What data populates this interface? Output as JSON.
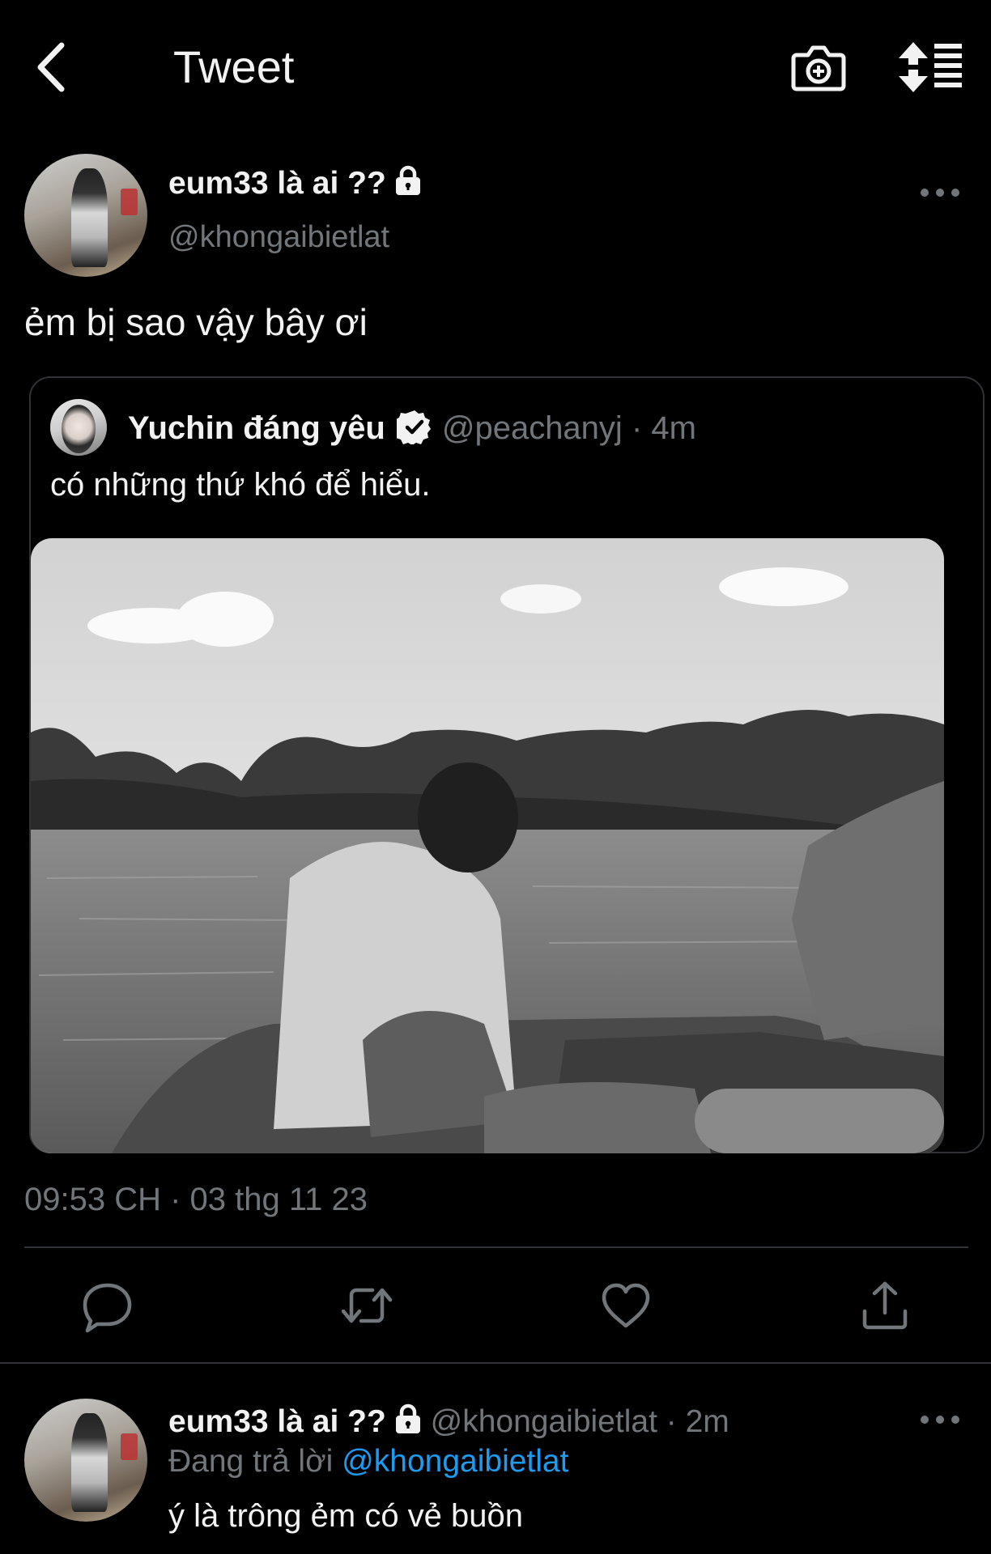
{
  "header": {
    "title": "Tweet",
    "back_icon": "chevron-left-icon",
    "camera_icon": "camera-add-icon",
    "sort_icon": "sort-list-icon"
  },
  "tweet": {
    "author": {
      "display_name": "eum33 là ai ??",
      "handle": "@khongaibietlat",
      "protected_icon": "lock-icon"
    },
    "text": "ẻm bị sao vậy bây ơi",
    "timestamp": "09:53 CH · 03 thg 11 23",
    "quote": {
      "display_name": "Yuchin đáng yêu",
      "verified_icon": "verified-badge-icon",
      "handle": "@peachanyj",
      "separator": "·",
      "time": "4m",
      "text": "có những thứ khó để hiểu.",
      "media": "black-and-white photo of a person sitting in a boat on a lake"
    },
    "actions": [
      {
        "name": "reply",
        "icon": "reply-icon"
      },
      {
        "name": "retweet",
        "icon": "retweet-icon"
      },
      {
        "name": "like",
        "icon": "heart-icon"
      },
      {
        "name": "share",
        "icon": "share-icon"
      }
    ]
  },
  "reply": {
    "display_name": "eum33 là ai ??",
    "handle": "@khongaibietlat",
    "separator": "·",
    "time": "2m",
    "replying_prefix": "Đang trả lời",
    "replying_to": "@khongaibietlat",
    "text": "ý là trông ẻm có vẻ buồn"
  },
  "colors": {
    "background": "#000000",
    "text": "#f2f2f2",
    "secondary": "#71767b",
    "link": "#1d9bf0",
    "border": "#2f3336"
  }
}
